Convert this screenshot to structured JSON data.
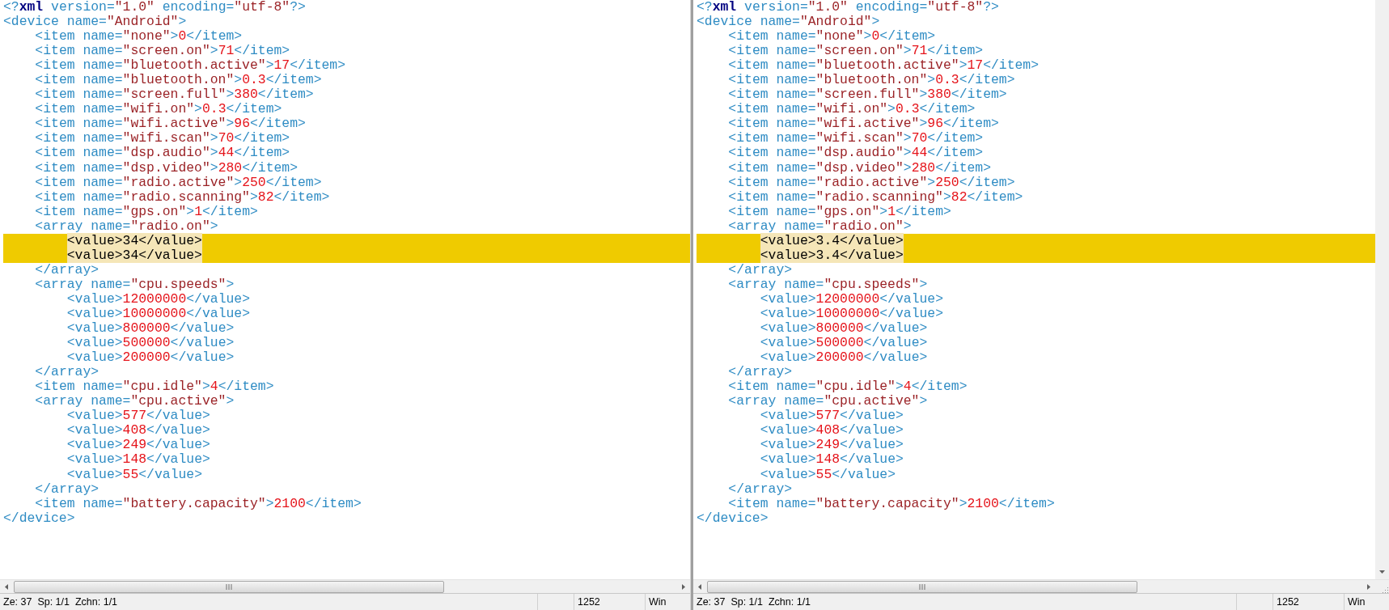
{
  "panes": [
    {
      "lines": [
        {
          "text": "<?xml version=\"1.0\" encoding=\"utf-8\"?>",
          "changed": false
        },
        {
          "text": "<device name=\"Android\">",
          "changed": false
        },
        {
          "text": "    <item name=\"none\">0</item>",
          "changed": false
        },
        {
          "text": "    <item name=\"screen.on\">71</item>",
          "changed": false
        },
        {
          "text": "    <item name=\"bluetooth.active\">17</item>",
          "changed": false
        },
        {
          "text": "    <item name=\"bluetooth.on\">0.3</item>",
          "changed": false
        },
        {
          "text": "    <item name=\"screen.full\">380</item>",
          "changed": false
        },
        {
          "text": "    <item name=\"wifi.on\">0.3</item>",
          "changed": false
        },
        {
          "text": "    <item name=\"wifi.active\">96</item>",
          "changed": false
        },
        {
          "text": "    <item name=\"wifi.scan\">70</item>",
          "changed": false
        },
        {
          "text": "    <item name=\"dsp.audio\">44</item>",
          "changed": false
        },
        {
          "text": "    <item name=\"dsp.video\">280</item>",
          "changed": false
        },
        {
          "text": "    <item name=\"radio.active\">250</item>",
          "changed": false
        },
        {
          "text": "    <item name=\"radio.scanning\">82</item>",
          "changed": false
        },
        {
          "text": "    <item name=\"gps.on\">1</item>",
          "changed": false
        },
        {
          "text": "    <array name=\"radio.on\">",
          "changed": false
        },
        {
          "text": "        <value>34</value>",
          "changed": true
        },
        {
          "text": "        <value>34</value>",
          "changed": true
        },
        {
          "text": "    </array>",
          "changed": false
        },
        {
          "text": "    <array name=\"cpu.speeds\">",
          "changed": false
        },
        {
          "text": "        <value>12000000</value>",
          "changed": false
        },
        {
          "text": "        <value>10000000</value>",
          "changed": false
        },
        {
          "text": "        <value>800000</value>",
          "changed": false
        },
        {
          "text": "        <value>500000</value>",
          "changed": false
        },
        {
          "text": "        <value>200000</value>",
          "changed": false
        },
        {
          "text": "    </array>",
          "changed": false
        },
        {
          "text": "    <item name=\"cpu.idle\">4</item>",
          "changed": false
        },
        {
          "text": "    <array name=\"cpu.active\">",
          "changed": false
        },
        {
          "text": "        <value>577</value>",
          "changed": false
        },
        {
          "text": "        <value>408</value>",
          "changed": false
        },
        {
          "text": "        <value>249</value>",
          "changed": false
        },
        {
          "text": "        <value>148</value>",
          "changed": false
        },
        {
          "text": "        <value>55</value>",
          "changed": false
        },
        {
          "text": "    </array>",
          "changed": false
        },
        {
          "text": "    <item name=\"battery.capacity\">2100</item>",
          "changed": false
        },
        {
          "text": "</device>",
          "changed": false
        }
      ],
      "status": {
        "position": "Ze: 37  Sp: 1/1  Zchn: 1/1",
        "codepage": "1252",
        "line_ending": "Win"
      }
    },
    {
      "lines": [
        {
          "text": "<?xml version=\"1.0\" encoding=\"utf-8\"?>",
          "changed": false
        },
        {
          "text": "<device name=\"Android\">",
          "changed": false
        },
        {
          "text": "    <item name=\"none\">0</item>",
          "changed": false
        },
        {
          "text": "    <item name=\"screen.on\">71</item>",
          "changed": false
        },
        {
          "text": "    <item name=\"bluetooth.active\">17</item>",
          "changed": false
        },
        {
          "text": "    <item name=\"bluetooth.on\">0.3</item>",
          "changed": false
        },
        {
          "text": "    <item name=\"screen.full\">380</item>",
          "changed": false
        },
        {
          "text": "    <item name=\"wifi.on\">0.3</item>",
          "changed": false
        },
        {
          "text": "    <item name=\"wifi.active\">96</item>",
          "changed": false
        },
        {
          "text": "    <item name=\"wifi.scan\">70</item>",
          "changed": false
        },
        {
          "text": "    <item name=\"dsp.audio\">44</item>",
          "changed": false
        },
        {
          "text": "    <item name=\"dsp.video\">280</item>",
          "changed": false
        },
        {
          "text": "    <item name=\"radio.active\">250</item>",
          "changed": false
        },
        {
          "text": "    <item name=\"radio.scanning\">82</item>",
          "changed": false
        },
        {
          "text": "    <item name=\"gps.on\">1</item>",
          "changed": false
        },
        {
          "text": "    <array name=\"radio.on\">",
          "changed": false
        },
        {
          "text": "        <value>3.4</value>",
          "changed": true
        },
        {
          "text": "        <value>3.4</value>",
          "changed": true
        },
        {
          "text": "    </array>",
          "changed": false
        },
        {
          "text": "    <array name=\"cpu.speeds\">",
          "changed": false
        },
        {
          "text": "        <value>12000000</value>",
          "changed": false
        },
        {
          "text": "        <value>10000000</value>",
          "changed": false
        },
        {
          "text": "        <value>800000</value>",
          "changed": false
        },
        {
          "text": "        <value>500000</value>",
          "changed": false
        },
        {
          "text": "        <value>200000</value>",
          "changed": false
        },
        {
          "text": "    </array>",
          "changed": false
        },
        {
          "text": "    <item name=\"cpu.idle\">4</item>",
          "changed": false
        },
        {
          "text": "    <array name=\"cpu.active\">",
          "changed": false
        },
        {
          "text": "        <value>577</value>",
          "changed": false
        },
        {
          "text": "        <value>408</value>",
          "changed": false
        },
        {
          "text": "        <value>249</value>",
          "changed": false
        },
        {
          "text": "        <value>148</value>",
          "changed": false
        },
        {
          "text": "        <value>55</value>",
          "changed": false
        },
        {
          "text": "    </array>",
          "changed": false
        },
        {
          "text": "    <item name=\"battery.capacity\">2100</item>",
          "changed": false
        },
        {
          "text": "</device>",
          "changed": false
        }
      ],
      "status": {
        "position": "Ze: 37  Sp: 1/1  Zchn: 1/1",
        "codepage": "1252",
        "line_ending": "Win"
      }
    }
  ]
}
